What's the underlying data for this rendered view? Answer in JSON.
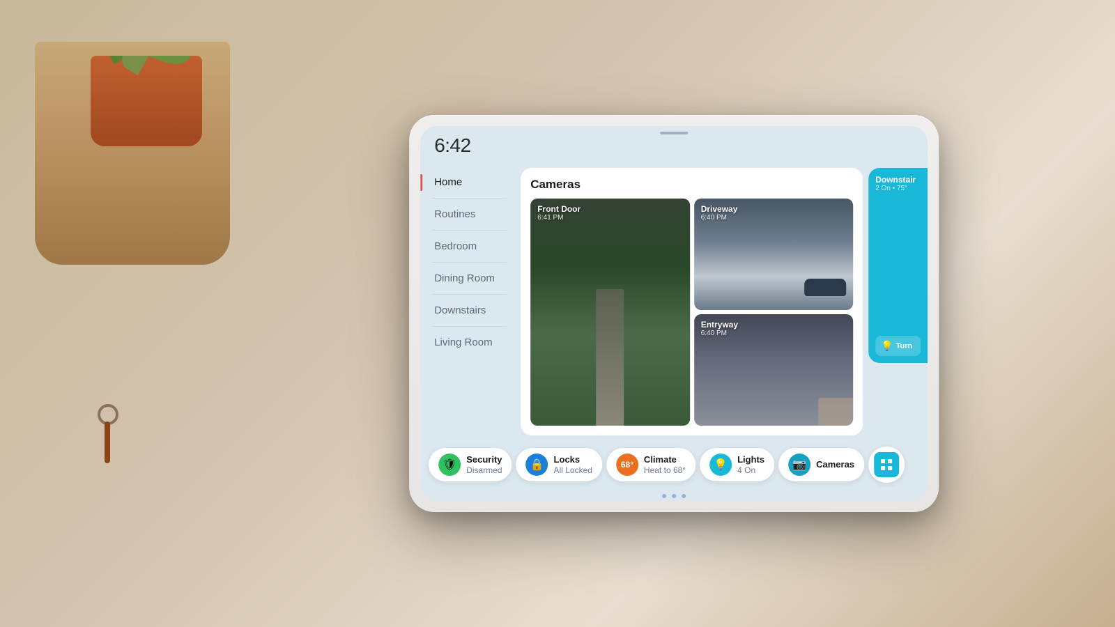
{
  "background": {
    "color": "#d4c4b0"
  },
  "time": "6:42",
  "sidebar": {
    "items": [
      {
        "label": "Home",
        "active": true
      },
      {
        "label": "Routines",
        "active": false
      },
      {
        "label": "Bedroom",
        "active": false
      },
      {
        "label": "Dining Room",
        "active": false
      },
      {
        "label": "Downstairs",
        "active": false
      },
      {
        "label": "Living Room",
        "active": false
      }
    ]
  },
  "cameras": {
    "section_title": "Cameras",
    "feeds": [
      {
        "name": "Front Door",
        "time": "6:41 PM",
        "class": "front-door"
      },
      {
        "name": "Driveway",
        "time": "6:40 PM",
        "class": "driveway"
      },
      {
        "name": "Entryway",
        "time": "6:40 PM",
        "class": "entryway"
      }
    ]
  },
  "right_panel": {
    "title": "Downstair",
    "subtitle": "2 On • 75°",
    "button_label": "Turn"
  },
  "status_bar": {
    "items": [
      {
        "id": "security",
        "label": "Security",
        "value": "Disarmed",
        "icon": "🛡",
        "icon_style": "green"
      },
      {
        "id": "locks",
        "label": "Locks",
        "value": "All Locked",
        "icon": "🔒",
        "icon_style": "blue"
      },
      {
        "id": "climate",
        "label": "Climate",
        "value": "Heat to 68°",
        "icon": "68°",
        "icon_style": "orange"
      },
      {
        "id": "lights",
        "label": "Lights",
        "value": "4 On",
        "icon": "💡",
        "icon_style": "teal"
      },
      {
        "id": "cameras",
        "label": "Cameras",
        "value": "",
        "icon": "📷",
        "icon_style": "dark-teal"
      },
      {
        "id": "grid",
        "label": "",
        "value": "",
        "icon": "⊞",
        "icon_style": "square"
      }
    ]
  },
  "page_dots": [
    1,
    2,
    3
  ]
}
